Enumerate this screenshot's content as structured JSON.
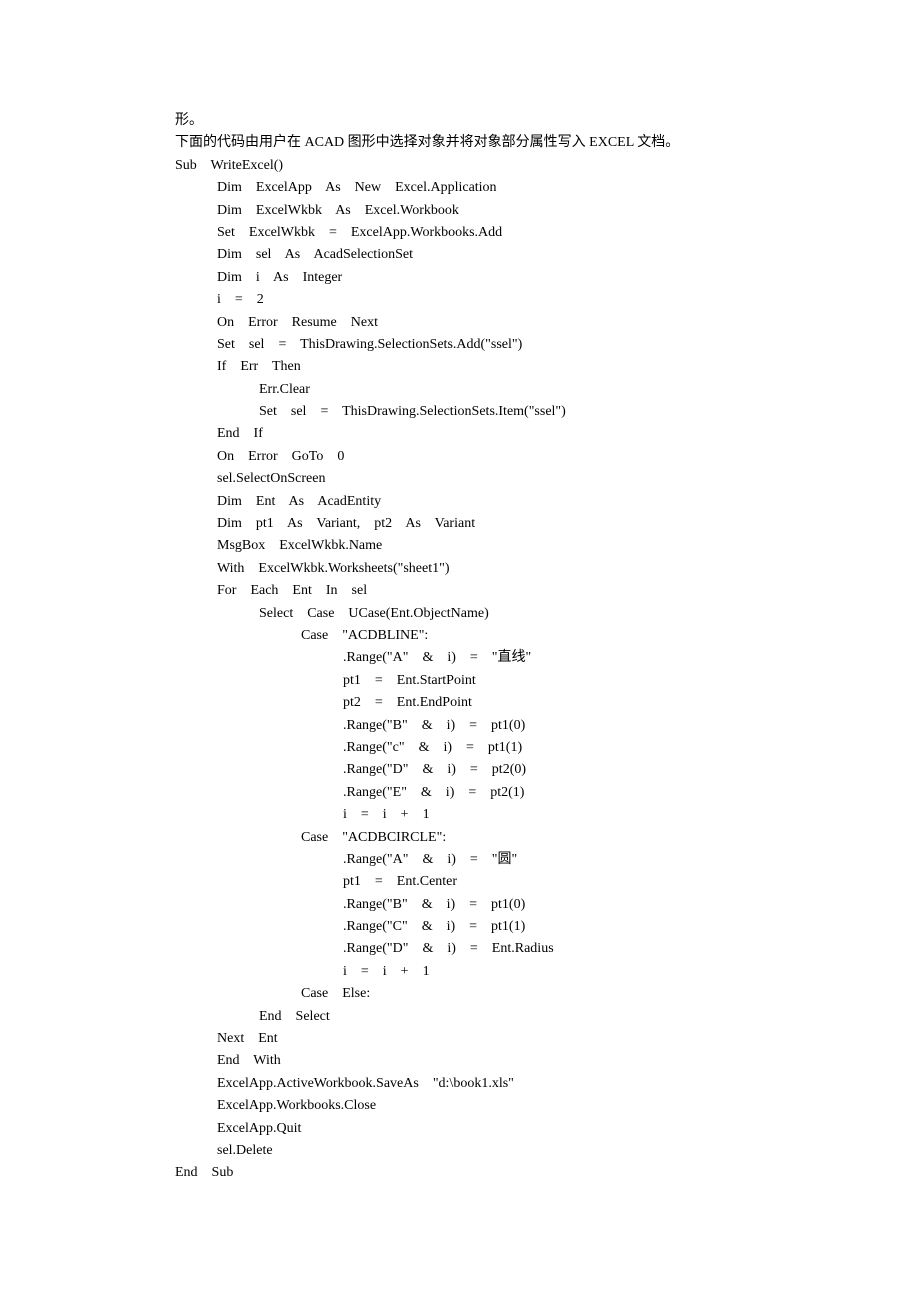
{
  "lines": [
    {
      "indent": 0,
      "text": "形。"
    },
    {
      "indent": 0,
      "text": "下面的代码由用户在 ACAD 图形中选择对象并将对象部分属性写入 EXCEL 文档。"
    },
    {
      "indent": 0,
      "text": "Sub    WriteExcel()"
    },
    {
      "indent": 1,
      "text": "Dim    ExcelApp    As    New    Excel.Application"
    },
    {
      "indent": 1,
      "text": "Dim    ExcelWkbk    As    Excel.Workbook"
    },
    {
      "indent": 1,
      "text": "Set    ExcelWkbk    =    ExcelApp.Workbooks.Add"
    },
    {
      "indent": 1,
      "text": "Dim    sel    As    AcadSelectionSet"
    },
    {
      "indent": 1,
      "text": "Dim    i    As    Integer"
    },
    {
      "indent": 1,
      "text": "i    =    2"
    },
    {
      "indent": 1,
      "text": "On    Error    Resume    Next"
    },
    {
      "indent": 1,
      "text": "Set    sel    =    ThisDrawing.SelectionSets.Add(\"ssel\")"
    },
    {
      "indent": 1,
      "text": "If    Err    Then"
    },
    {
      "indent": 2,
      "text": "Err.Clear"
    },
    {
      "indent": 2,
      "text": "Set    sel    =    ThisDrawing.SelectionSets.Item(\"ssel\")"
    },
    {
      "indent": 1,
      "text": "End    If"
    },
    {
      "indent": 1,
      "text": "On    Error    GoTo    0"
    },
    {
      "indent": 1,
      "text": "sel.SelectOnScreen"
    },
    {
      "indent": 1,
      "text": "Dim    Ent    As    AcadEntity"
    },
    {
      "indent": 1,
      "text": "Dim    pt1    As    Variant,    pt2    As    Variant"
    },
    {
      "indent": 1,
      "text": "MsgBox    ExcelWkbk.Name"
    },
    {
      "indent": 1,
      "text": "With    ExcelWkbk.Worksheets(\"sheet1\")"
    },
    {
      "indent": 1,
      "text": "For    Each    Ent    In    sel"
    },
    {
      "indent": 2,
      "text": "Select    Case    UCase(Ent.ObjectName)"
    },
    {
      "indent": 3,
      "text": "Case    \"ACDBLINE\":"
    },
    {
      "indent": 4,
      "text": ".Range(\"A\"    &    i)    =    \"直线\""
    },
    {
      "indent": 4,
      "text": "pt1    =    Ent.StartPoint"
    },
    {
      "indent": 4,
      "text": "pt2    =    Ent.EndPoint"
    },
    {
      "indent": 4,
      "text": ".Range(\"B\"    &    i)    =    pt1(0)"
    },
    {
      "indent": 4,
      "text": ".Range(\"c\"    &    i)    =    pt1(1)"
    },
    {
      "indent": 4,
      "text": ".Range(\"D\"    &    i)    =    pt2(0)"
    },
    {
      "indent": 4,
      "text": ".Range(\"E\"    &    i)    =    pt2(1)"
    },
    {
      "indent": 4,
      "text": "i    =    i    +    1"
    },
    {
      "indent": 3,
      "text": "Case    \"ACDBCIRCLE\":"
    },
    {
      "indent": 4,
      "text": ".Range(\"A\"    &    i)    =    \"圆\""
    },
    {
      "indent": 4,
      "text": "pt1    =    Ent.Center"
    },
    {
      "indent": 4,
      "text": ".Range(\"B\"    &    i)    =    pt1(0)"
    },
    {
      "indent": 4,
      "text": ".Range(\"C\"    &    i)    =    pt1(1)"
    },
    {
      "indent": 4,
      "text": ".Range(\"D\"    &    i)    =    Ent.Radius"
    },
    {
      "indent": 4,
      "text": "i    =    i    +    1"
    },
    {
      "indent": 3,
      "text": "Case    Else:"
    },
    {
      "indent": 2,
      "text": "End    Select"
    },
    {
      "indent": 1,
      "text": "Next    Ent"
    },
    {
      "indent": 1,
      "text": "End    With"
    },
    {
      "indent": 1,
      "text": "ExcelApp.ActiveWorkbook.SaveAs    \"d:\\book1.xls\""
    },
    {
      "indent": 1,
      "text": "ExcelApp.Workbooks.Close"
    },
    {
      "indent": 1,
      "text": "ExcelApp.Quit"
    },
    {
      "indent": 1,
      "text": "sel.Delete"
    },
    {
      "indent": 0,
      "text": "End    Sub"
    }
  ]
}
